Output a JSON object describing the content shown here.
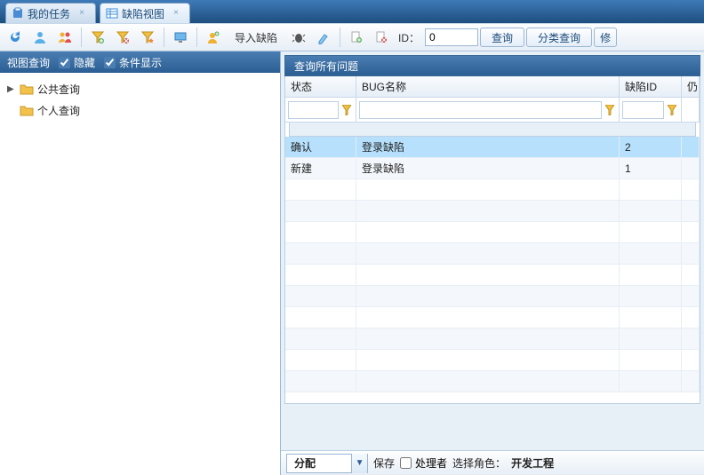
{
  "tabs": [
    {
      "label": "我的任务",
      "icon": "clipboard"
    },
    {
      "label": "缺陷视图",
      "icon": "grid"
    }
  ],
  "toolbar": {
    "import_label": "导入缺陷",
    "id_label": "ID：",
    "id_value": "0",
    "query_label": "查询",
    "category_query_label": "分类查询",
    "edit_partial": "修"
  },
  "left_panel": {
    "title": "视图查询",
    "hide_label": "隐藏",
    "hide_checked": true,
    "cond_label": "条件显示",
    "cond_checked": true,
    "nodes": [
      {
        "label": "公共查询",
        "expandable": true
      },
      {
        "label": "个人查询",
        "expandable": false
      }
    ]
  },
  "right_panel": {
    "title": "查询所有问题",
    "columns": {
      "status": "状态",
      "name": "BUG名称",
      "id": "缺陷ID",
      "extra": "仍"
    },
    "rows": [
      {
        "status": "确认",
        "name": "登录缺陷",
        "id": "2",
        "selected": true
      },
      {
        "status": "新建",
        "name": "登录缺陷",
        "id": "1",
        "selected": false
      }
    ]
  },
  "bottom": {
    "combo_value": "分配",
    "save_label": "保存",
    "handler_label": "处理者",
    "role_label": "选择角色：",
    "role_value": "开发工程"
  }
}
